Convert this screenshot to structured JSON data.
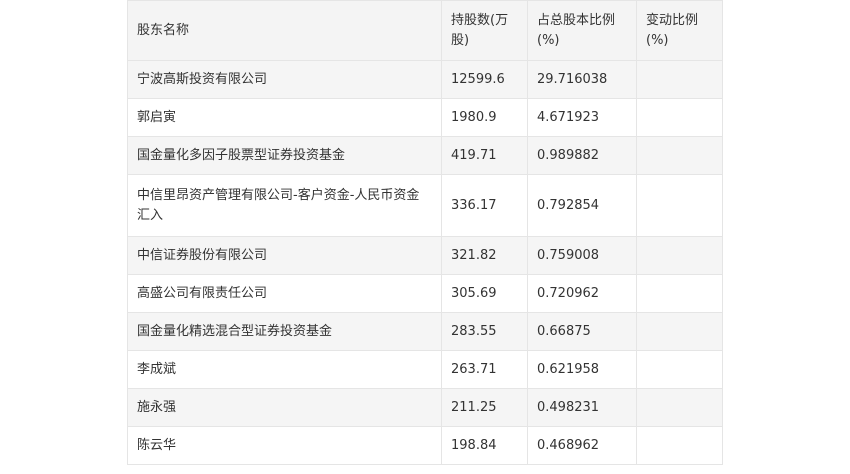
{
  "table": {
    "headers": [
      "股东名称",
      "持股数(万股)",
      "占总股本比例(%)",
      "变动比例(%)"
    ],
    "rows": [
      {
        "name": "宁波高斯投资有限公司",
        "shares": "12599.6",
        "ratio": "29.716038",
        "change": ""
      },
      {
        "name": "郭启寅",
        "shares": "1980.9",
        "ratio": "4.671923",
        "change": ""
      },
      {
        "name": "国金量化多因子股票型证券投资基金",
        "shares": "419.71",
        "ratio": "0.989882",
        "change": ""
      },
      {
        "name": "中信里昂资产管理有限公司-客户资金-人民币资金汇入",
        "shares": "336.17",
        "ratio": "0.792854",
        "change": ""
      },
      {
        "name": "中信证券股份有限公司",
        "shares": "321.82",
        "ratio": "0.759008",
        "change": ""
      },
      {
        "name": "高盛公司有限责任公司",
        "shares": "305.69",
        "ratio": "0.720962",
        "change": ""
      },
      {
        "name": "国金量化精选混合型证券投资基金",
        "shares": "283.55",
        "ratio": "0.66875",
        "change": ""
      },
      {
        "name": "李成斌",
        "shares": "263.71",
        "ratio": "0.621958",
        "change": ""
      },
      {
        "name": "施永强",
        "shares": "211.25",
        "ratio": "0.498231",
        "change": ""
      },
      {
        "name": "陈云华",
        "shares": "198.84",
        "ratio": "0.468962",
        "change": ""
      }
    ]
  }
}
